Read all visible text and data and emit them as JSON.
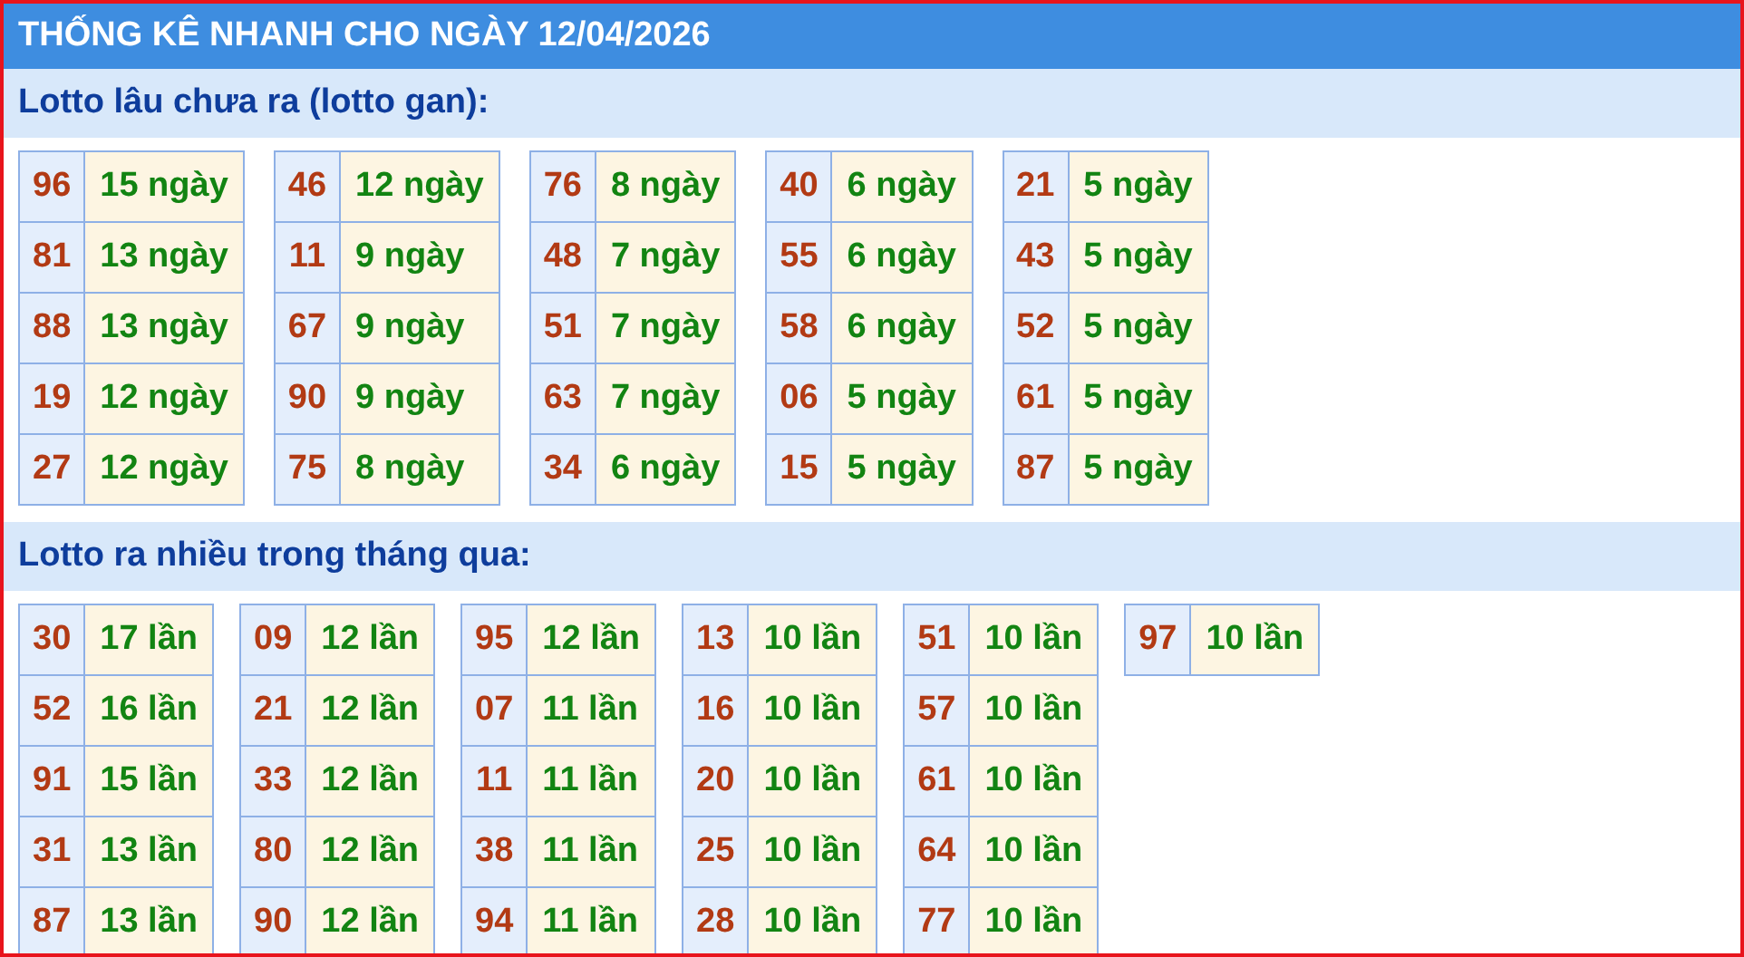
{
  "title": "THỐNG KÊ NHANH CHO NGÀY 12/04/2026",
  "sections": [
    {
      "title": "Lotto lâu chưa ra (lotto gan):",
      "groups": [
        [
          {
            "number": "96",
            "value": "15 ngày"
          },
          {
            "number": "81",
            "value": "13 ngày"
          },
          {
            "number": "88",
            "value": "13 ngày"
          },
          {
            "number": "19",
            "value": "12 ngày"
          },
          {
            "number": "27",
            "value": "12 ngày"
          }
        ],
        [
          {
            "number": "46",
            "value": "12 ngày"
          },
          {
            "number": "11",
            "value": "9 ngày"
          },
          {
            "number": "67",
            "value": "9 ngày"
          },
          {
            "number": "90",
            "value": "9 ngày"
          },
          {
            "number": "75",
            "value": "8 ngày"
          }
        ],
        [
          {
            "number": "76",
            "value": "8 ngày"
          },
          {
            "number": "48",
            "value": "7 ngày"
          },
          {
            "number": "51",
            "value": "7 ngày"
          },
          {
            "number": "63",
            "value": "7 ngày"
          },
          {
            "number": "34",
            "value": "6 ngày"
          }
        ],
        [
          {
            "number": "40",
            "value": "6 ngày"
          },
          {
            "number": "55",
            "value": "6 ngày"
          },
          {
            "number": "58",
            "value": "6 ngày"
          },
          {
            "number": "06",
            "value": "5 ngày"
          },
          {
            "number": "15",
            "value": "5 ngày"
          }
        ],
        [
          {
            "number": "21",
            "value": "5 ngày"
          },
          {
            "number": "43",
            "value": "5 ngày"
          },
          {
            "number": "52",
            "value": "5 ngày"
          },
          {
            "number": "61",
            "value": "5 ngày"
          },
          {
            "number": "87",
            "value": "5 ngày"
          }
        ]
      ]
    },
    {
      "title": "Lotto ra nhiều trong tháng qua:",
      "groups": [
        [
          {
            "number": "30",
            "value": "17 lần"
          },
          {
            "number": "52",
            "value": "16 lần"
          },
          {
            "number": "91",
            "value": "15 lần"
          },
          {
            "number": "31",
            "value": "13 lần"
          },
          {
            "number": "87",
            "value": "13 lần"
          }
        ],
        [
          {
            "number": "09",
            "value": "12 lần"
          },
          {
            "number": "21",
            "value": "12 lần"
          },
          {
            "number": "33",
            "value": "12 lần"
          },
          {
            "number": "80",
            "value": "12 lần"
          },
          {
            "number": "90",
            "value": "12 lần"
          }
        ],
        [
          {
            "number": "95",
            "value": "12 lần"
          },
          {
            "number": "07",
            "value": "11 lần"
          },
          {
            "number": "11",
            "value": "11 lần"
          },
          {
            "number": "38",
            "value": "11 lần"
          },
          {
            "number": "94",
            "value": "11 lần"
          }
        ],
        [
          {
            "number": "13",
            "value": "10 lần"
          },
          {
            "number": "16",
            "value": "10 lần"
          },
          {
            "number": "20",
            "value": "10 lần"
          },
          {
            "number": "25",
            "value": "10 lần"
          },
          {
            "number": "28",
            "value": "10 lần"
          }
        ],
        [
          {
            "number": "51",
            "value": "10 lần"
          },
          {
            "number": "57",
            "value": "10 lần"
          },
          {
            "number": "61",
            "value": "10 lần"
          },
          {
            "number": "64",
            "value": "10 lần"
          },
          {
            "number": "77",
            "value": "10 lần"
          }
        ],
        [
          {
            "number": "97",
            "value": "10 lần"
          }
        ]
      ]
    }
  ]
}
